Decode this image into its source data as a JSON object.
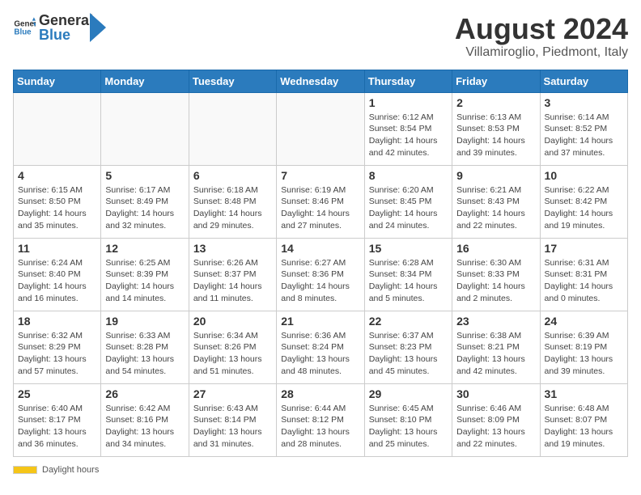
{
  "header": {
    "logo_general": "General",
    "logo_blue": "Blue",
    "month_title": "August 2024",
    "location": "Villamiroglio, Piedmont, Italy"
  },
  "weekdays": [
    "Sunday",
    "Monday",
    "Tuesday",
    "Wednesday",
    "Thursday",
    "Friday",
    "Saturday"
  ],
  "weeks": [
    [
      {
        "day": "",
        "info": ""
      },
      {
        "day": "",
        "info": ""
      },
      {
        "day": "",
        "info": ""
      },
      {
        "day": "",
        "info": ""
      },
      {
        "day": "1",
        "info": "Sunrise: 6:12 AM\nSunset: 8:54 PM\nDaylight: 14 hours and 42 minutes."
      },
      {
        "day": "2",
        "info": "Sunrise: 6:13 AM\nSunset: 8:53 PM\nDaylight: 14 hours and 39 minutes."
      },
      {
        "day": "3",
        "info": "Sunrise: 6:14 AM\nSunset: 8:52 PM\nDaylight: 14 hours and 37 minutes."
      }
    ],
    [
      {
        "day": "4",
        "info": "Sunrise: 6:15 AM\nSunset: 8:50 PM\nDaylight: 14 hours and 35 minutes."
      },
      {
        "day": "5",
        "info": "Sunrise: 6:17 AM\nSunset: 8:49 PM\nDaylight: 14 hours and 32 minutes."
      },
      {
        "day": "6",
        "info": "Sunrise: 6:18 AM\nSunset: 8:48 PM\nDaylight: 14 hours and 29 minutes."
      },
      {
        "day": "7",
        "info": "Sunrise: 6:19 AM\nSunset: 8:46 PM\nDaylight: 14 hours and 27 minutes."
      },
      {
        "day": "8",
        "info": "Sunrise: 6:20 AM\nSunset: 8:45 PM\nDaylight: 14 hours and 24 minutes."
      },
      {
        "day": "9",
        "info": "Sunrise: 6:21 AM\nSunset: 8:43 PM\nDaylight: 14 hours and 22 minutes."
      },
      {
        "day": "10",
        "info": "Sunrise: 6:22 AM\nSunset: 8:42 PM\nDaylight: 14 hours and 19 minutes."
      }
    ],
    [
      {
        "day": "11",
        "info": "Sunrise: 6:24 AM\nSunset: 8:40 PM\nDaylight: 14 hours and 16 minutes."
      },
      {
        "day": "12",
        "info": "Sunrise: 6:25 AM\nSunset: 8:39 PM\nDaylight: 14 hours and 14 minutes."
      },
      {
        "day": "13",
        "info": "Sunrise: 6:26 AM\nSunset: 8:37 PM\nDaylight: 14 hours and 11 minutes."
      },
      {
        "day": "14",
        "info": "Sunrise: 6:27 AM\nSunset: 8:36 PM\nDaylight: 14 hours and 8 minutes."
      },
      {
        "day": "15",
        "info": "Sunrise: 6:28 AM\nSunset: 8:34 PM\nDaylight: 14 hours and 5 minutes."
      },
      {
        "day": "16",
        "info": "Sunrise: 6:30 AM\nSunset: 8:33 PM\nDaylight: 14 hours and 2 minutes."
      },
      {
        "day": "17",
        "info": "Sunrise: 6:31 AM\nSunset: 8:31 PM\nDaylight: 14 hours and 0 minutes."
      }
    ],
    [
      {
        "day": "18",
        "info": "Sunrise: 6:32 AM\nSunset: 8:29 PM\nDaylight: 13 hours and 57 minutes."
      },
      {
        "day": "19",
        "info": "Sunrise: 6:33 AM\nSunset: 8:28 PM\nDaylight: 13 hours and 54 minutes."
      },
      {
        "day": "20",
        "info": "Sunrise: 6:34 AM\nSunset: 8:26 PM\nDaylight: 13 hours and 51 minutes."
      },
      {
        "day": "21",
        "info": "Sunrise: 6:36 AM\nSunset: 8:24 PM\nDaylight: 13 hours and 48 minutes."
      },
      {
        "day": "22",
        "info": "Sunrise: 6:37 AM\nSunset: 8:23 PM\nDaylight: 13 hours and 45 minutes."
      },
      {
        "day": "23",
        "info": "Sunrise: 6:38 AM\nSunset: 8:21 PM\nDaylight: 13 hours and 42 minutes."
      },
      {
        "day": "24",
        "info": "Sunrise: 6:39 AM\nSunset: 8:19 PM\nDaylight: 13 hours and 39 minutes."
      }
    ],
    [
      {
        "day": "25",
        "info": "Sunrise: 6:40 AM\nSunset: 8:17 PM\nDaylight: 13 hours and 36 minutes."
      },
      {
        "day": "26",
        "info": "Sunrise: 6:42 AM\nSunset: 8:16 PM\nDaylight: 13 hours and 34 minutes."
      },
      {
        "day": "27",
        "info": "Sunrise: 6:43 AM\nSunset: 8:14 PM\nDaylight: 13 hours and 31 minutes."
      },
      {
        "day": "28",
        "info": "Sunrise: 6:44 AM\nSunset: 8:12 PM\nDaylight: 13 hours and 28 minutes."
      },
      {
        "day": "29",
        "info": "Sunrise: 6:45 AM\nSunset: 8:10 PM\nDaylight: 13 hours and 25 minutes."
      },
      {
        "day": "30",
        "info": "Sunrise: 6:46 AM\nSunset: 8:09 PM\nDaylight: 13 hours and 22 minutes."
      },
      {
        "day": "31",
        "info": "Sunrise: 6:48 AM\nSunset: 8:07 PM\nDaylight: 13 hours and 19 minutes."
      }
    ]
  ],
  "footer": {
    "daylight_label": "Daylight hours"
  }
}
